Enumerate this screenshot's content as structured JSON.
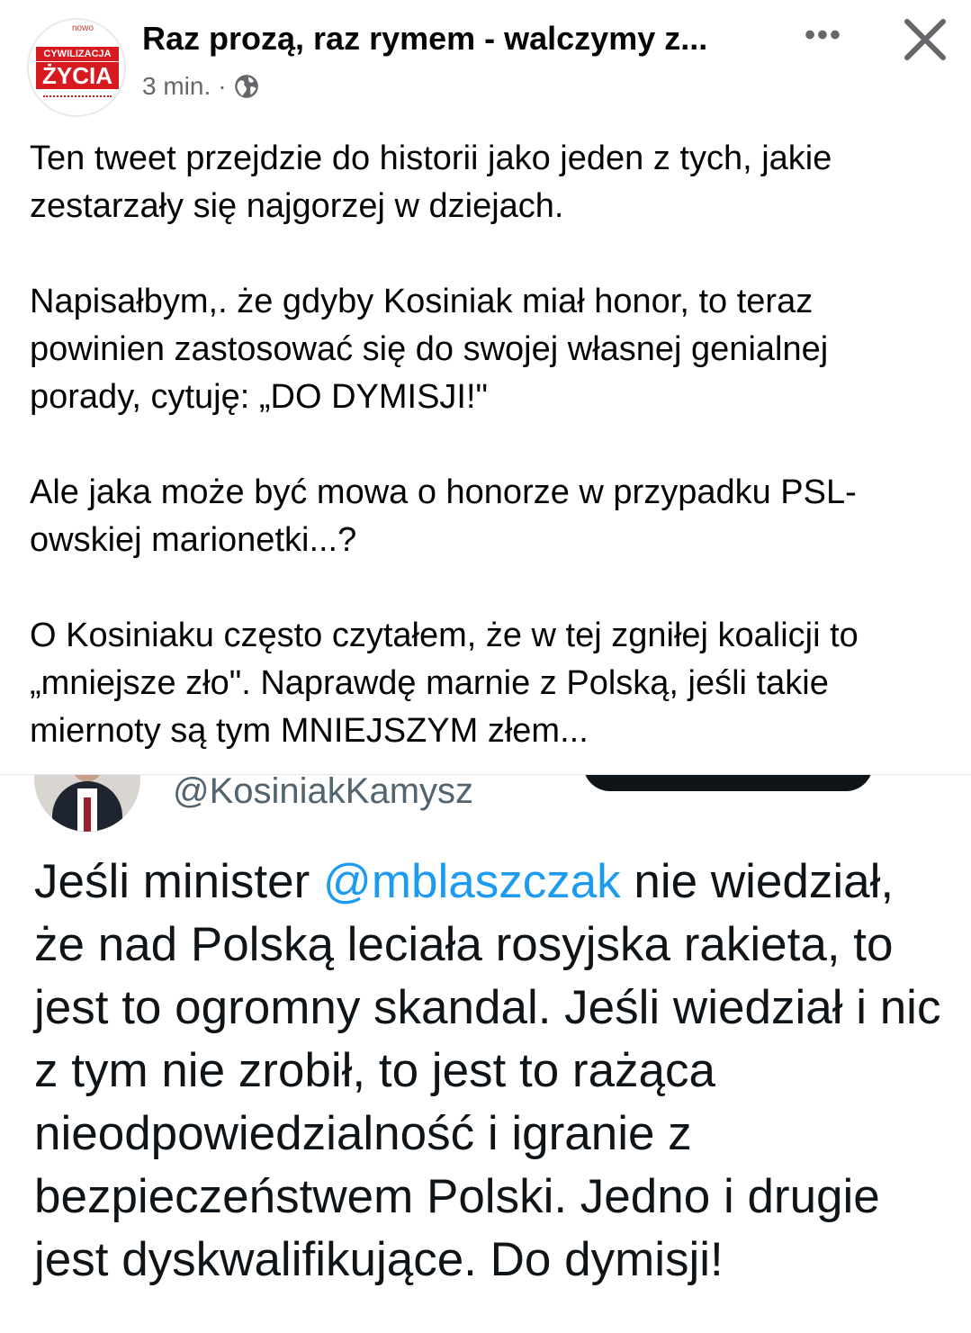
{
  "header": {
    "avatar_text_top": "nowo",
    "avatar_text_line1": "CYWILIZACJA",
    "avatar_text_line2": "ŻYCIA",
    "title": "Raz prozą, raz rymem - walczymy z...",
    "time": "3 min.",
    "separator": "·",
    "privacy_icon": "globe-icon",
    "more_label": "•••",
    "close_icon": "close-icon"
  },
  "post": {
    "paragraphs": [
      "Ten tweet przejdzie do historii jako jeden z tych, jakie zestarzały się najgorzej w dziejach.",
      "Napisałbym,. że gdyby Kosiniak miał honor, to teraz powinien zastosować się do swojej własnej genialnej porady, cytuję: „DO DYMISJI!\"",
      "Ale jaka może być mowa o honorze w przypadku PSL-owskiej marionetki...?",
      "O Kosiniaku często czytałem, że w tej  zgniłej koalicji to „mniejsze zło\". Naprawdę marnie z Polską, jeśli takie miernoty są tym MNIEJSZYM złem..."
    ]
  },
  "tweet": {
    "handle": "@KosiniakKamysz",
    "text_before": "Jeśli minister ",
    "mention": "@mblaszczak",
    "text_after": " nie wiedział, że nad Polską leciała rosyjska rakieta, to jest to ogromny skandal. Jeśli wiedział i nic z tym nie zrobił, to jest to rażąca nieodpowiedzialność i igranie z bezpieczeństwem Polski. Jedno i drugie jest dyskwalifikujące. Do dymisji!",
    "colors": {
      "mention": "#1d9bf0",
      "text": "#0f1419",
      "handle": "#536471"
    }
  }
}
